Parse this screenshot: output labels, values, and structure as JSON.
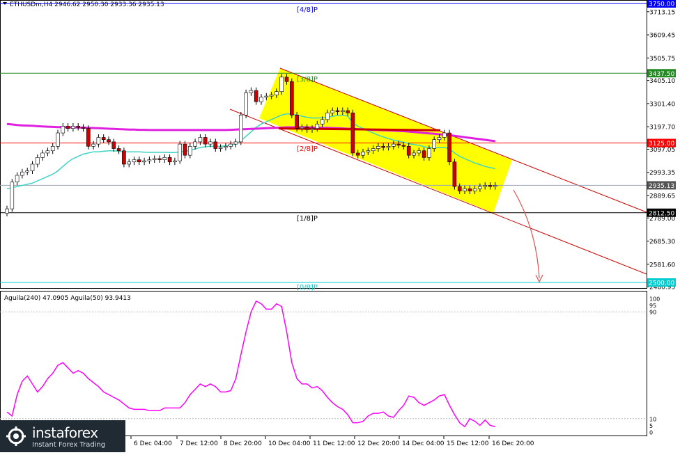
{
  "header": {
    "symbol_line": "ETHUSDm,H4  2946.62 2950.30 2933.36 2935.13"
  },
  "indicator": {
    "label": "Aguila(240) 47.0905  Aguila(50) 93.9413",
    "levels": [
      "100",
      "95",
      "90",
      "10",
      "5",
      "0"
    ]
  },
  "murrey_labels": {
    "l4": "[4/8]P",
    "l3": "[3/8]P",
    "l2": "[2/8]P",
    "l1": "[1/8]P",
    "l0": "[0/8]P"
  },
  "colors": {
    "price_up": "#1a7a1a",
    "price_down": "#cc0000",
    "sma_long": "#e020e0",
    "sma_short": "#3dd4c4",
    "channel_fill": "#ffff00",
    "line_4_8": "#0000ff",
    "line_3_8": "#228b22",
    "line_2_8": "#ff0000",
    "line_1_8": "#000000",
    "line_0_8": "#00ced1",
    "oscillator": "#ff00ff"
  },
  "logo": {
    "brand": "instaforex",
    "tagline": "Instant Forex Trading"
  },
  "chart_data": [
    {
      "type": "candlestick",
      "title": "ETHUSDm,H4",
      "ohlc_header": {
        "open": 2946.62,
        "high": 2950.3,
        "low": 2933.36,
        "close": 2935.13
      },
      "y_ticks": [
        3713.15,
        3609.45,
        3505.75,
        3405.1,
        3301.4,
        3197.7,
        3097.05,
        2993.35,
        2889.65,
        2789.0,
        2685.3,
        2581.6,
        2480.95
      ],
      "x_ticks": [
        "6 Dec 04:00",
        "7 Dec 12:00",
        "8 Dec 20:00",
        "10 Dec 04:00",
        "11 Dec 12:00",
        "12 Dec 20:00",
        "14 Dec 04:00",
        "15 Dec 12:00",
        "16 Dec 20:00"
      ],
      "price_labels": [
        {
          "value": 3750.0,
          "label": "3750.00",
          "color": "#0000ff"
        },
        {
          "value": 3437.5,
          "label": "3437.50",
          "color": "#228b22"
        },
        {
          "value": 3125.0,
          "label": "3125.00",
          "color": "#ff0000"
        },
        {
          "value": 2935.13,
          "label": "2935.13",
          "color": "#555555"
        },
        {
          "value": 2812.5,
          "label": "2812.50",
          "color": "#000000"
        },
        {
          "value": 2500.0,
          "label": "2500.00",
          "color": "#00ced1"
        }
      ],
      "closes": [
        2830,
        2950,
        2980,
        2995,
        3000,
        3030,
        3060,
        3080,
        3090,
        3110,
        3170,
        3200,
        3190,
        3200,
        3195,
        3190,
        3110,
        3120,
        3150,
        3140,
        3130,
        3100,
        3090,
        3030,
        3040,
        3050,
        3040,
        3045,
        3050,
        3055,
        3050,
        3060,
        3040,
        3045,
        3120,
        3070,
        3110,
        3130,
        3150,
        3120,
        3130,
        3100,
        3105,
        3110,
        3120,
        3130,
        3250,
        3350,
        3360,
        3310,
        3330,
        3335,
        3340,
        3355,
        3420,
        3400,
        3250,
        3190,
        3195,
        3185,
        3190,
        3210,
        3230,
        3260,
        3270,
        3265,
        3270,
        3260,
        3080,
        3070,
        3085,
        3090,
        3100,
        3110,
        3105,
        3110,
        3120,
        3115,
        3110,
        3070,
        3080,
        3090,
        3060,
        3100,
        3140,
        3150,
        3170,
        3040,
        2930,
        2910,
        2920,
        2910,
        2920,
        2930,
        2935,
        2930,
        2935
      ],
      "sma_short": [
        2920,
        2925,
        2930,
        2935,
        2940,
        2945,
        2955,
        2965,
        2975,
        2985,
        3000,
        3020,
        3040,
        3055,
        3065,
        3075,
        3080,
        3085,
        3085,
        3088,
        3090,
        3090,
        3088,
        3085,
        3085,
        3085,
        3085,
        3084,
        3083,
        3083,
        3083,
        3083,
        3082,
        3082,
        3085,
        3087,
        3092,
        3098,
        3105,
        3108,
        3110,
        3110,
        3110,
        3112,
        3115,
        3120,
        3135,
        3155,
        3175,
        3195,
        3210,
        3220,
        3230,
        3240,
        3250,
        3255,
        3255,
        3250,
        3245,
        3240,
        3237,
        3237,
        3238,
        3240,
        3245,
        3248,
        3250,
        3245,
        3215,
        3200,
        3190,
        3180,
        3170,
        3160,
        3152,
        3145,
        3138,
        3133,
        3128,
        3122,
        3118,
        3115,
        3108,
        3105,
        3105,
        3104,
        3106,
        3098,
        3080,
        3065,
        3055,
        3045,
        3035,
        3028,
        3020,
        3015,
        3010
      ],
      "sma_long": [
        3210,
        3208,
        3205,
        3204,
        3203,
        3202,
        3200,
        3199,
        3198,
        3197,
        3196,
        3196,
        3195,
        3195,
        3194,
        3194,
        3193,
        3192,
        3191,
        3190,
        3189,
        3188,
        3187,
        3186,
        3185,
        3185,
        3184,
        3184,
        3183,
        3183,
        3183,
        3183,
        3183,
        3183,
        3183,
        3183,
        3183,
        3183,
        3183,
        3183,
        3183,
        3183,
        3183,
        3183,
        3184,
        3185,
        3186,
        3187,
        3188,
        3189,
        3190,
        3191,
        3192,
        3193,
        3194,
        3195,
        3195,
        3195,
        3195,
        3195,
        3194,
        3194,
        3193,
        3193,
        3192,
        3191,
        3190,
        3189,
        3188,
        3187,
        3186,
        3185,
        3184,
        3183,
        3182,
        3181,
        3180,
        3179,
        3178,
        3176,
        3174,
        3172,
        3170,
        3168,
        3166,
        3164,
        3162,
        3160,
        3157,
        3154,
        3151,
        3148,
        3145,
        3142,
        3139,
        3136,
        3133
      ],
      "oscillator_x_ticks": [
        "6 Dec 04:00",
        "7 Dec 12:00",
        "8 Dec 20:00",
        "10 Dec 04:00",
        "11 Dec 12:00",
        "12 Dec 20:00",
        "14 Dec 04:00",
        "15 Dec 12:00",
        "16 Dec 20:00"
      ],
      "oscillator": [
        15,
        12,
        28,
        38,
        42,
        36,
        30,
        34,
        40,
        44,
        50,
        52,
        48,
        44,
        46,
        44,
        40,
        37,
        34,
        30,
        28,
        26,
        24,
        21,
        18,
        17,
        17,
        17,
        16,
        16,
        16,
        18,
        18,
        18,
        18,
        22,
        28,
        32,
        36,
        34,
        36,
        34,
        30,
        30,
        31,
        40,
        58,
        75,
        90,
        98,
        96,
        92,
        92,
        96,
        94,
        75,
        52,
        40,
        36,
        36,
        33,
        34,
        31,
        26,
        22,
        19,
        17,
        13,
        7,
        7,
        8,
        12,
        14,
        14,
        15,
        12,
        11,
        16,
        20,
        27,
        26,
        22,
        20,
        22,
        24,
        27,
        28,
        20,
        13,
        7,
        4,
        10,
        8,
        5,
        9,
        5,
        4
      ]
    }
  ]
}
